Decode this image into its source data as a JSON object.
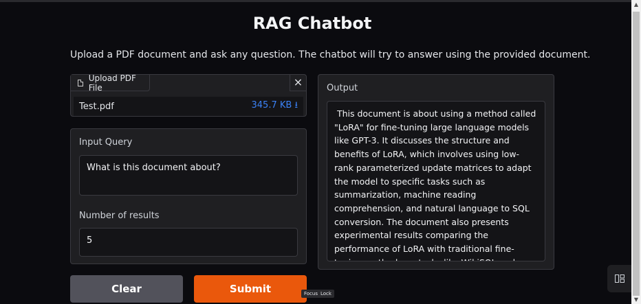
{
  "header": {
    "title": "RAG Chatbot",
    "description": "Upload a PDF document and ask any question. The chatbot will try to answer using the provided document."
  },
  "upload": {
    "tab_label": "Upload PDF File",
    "close_symbol": "×",
    "file_name": "Test.pdf",
    "file_size": "345.7 KB",
    "download_symbol": "⭳"
  },
  "query": {
    "label": "Input Query",
    "value": "What is this document about?"
  },
  "results": {
    "label": "Number of results",
    "value": "5"
  },
  "output": {
    "label": "Output",
    "text": " This document is about using a method called \"LoRA\" for fine-tuning large language models like GPT-3. It discusses the structure and benefits of LoRA, which involves using low-rank parameterized update matrices to adapt the model to specific tasks such as summarization, machine reading comprehension, and natural language to SQL conversion. The document also presents experimental results comparing the performance of LoRA with traditional fine-tuning methods on tasks like WikiSQL and MultiNLI."
  },
  "buttons": {
    "clear": "Clear",
    "submit": "Submit"
  },
  "tooltip": {
    "focus": "Focus",
    "lock": "Lock"
  },
  "scrollbar": {
    "up": "▲",
    "down": "▼"
  },
  "colors": {
    "accent": "#ea580c",
    "file_size": "#3b82f6"
  },
  "icons": {
    "file": "file-icon",
    "close": "close-icon",
    "download": "download-icon",
    "panel": "sidebar-toggle-icon"
  }
}
